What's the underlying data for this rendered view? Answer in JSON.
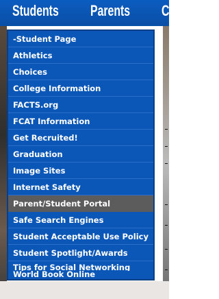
{
  "nav": {
    "tabs": [
      {
        "label": "Students"
      },
      {
        "label": "Parents"
      },
      {
        "label": "C"
      }
    ]
  },
  "menu": {
    "items": [
      {
        "label": "-Student Page"
      },
      {
        "label": "Athletics"
      },
      {
        "label": "Choices"
      },
      {
        "label": "College Information"
      },
      {
        "label": "FACTS.org"
      },
      {
        "label": "FCAT Information"
      },
      {
        "label": "Get Recruited!"
      },
      {
        "label": "Graduation"
      },
      {
        "label": "Image Sites"
      },
      {
        "label": "Internet Safety"
      },
      {
        "label": "Parent/Student Portal"
      },
      {
        "label": "Safe Search Engines"
      },
      {
        "label": "Student Acceptable Use Policy"
      },
      {
        "label": "Student Spotlight/Awards"
      },
      {
        "label": "Tips for Social Networking"
      },
      {
        "label": "World Book Online"
      }
    ],
    "highlighted_item": "Parent/Student Portal"
  },
  "colors": {
    "nav_background": "#0b5cc0",
    "menu_background": "#0b57b7",
    "menu_highlight": "#5c5c5c",
    "text": "#ffffff"
  }
}
